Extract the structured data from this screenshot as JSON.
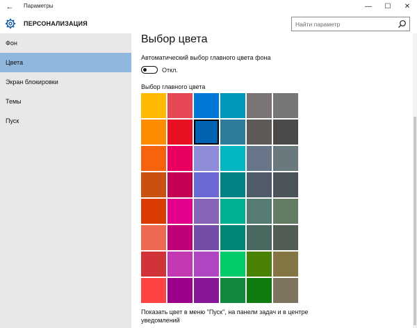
{
  "window": {
    "back_glyph": "←",
    "title": "Параметры",
    "minimize_glyph": "—",
    "maximize_glyph": "☐",
    "close_glyph": "✕"
  },
  "header": {
    "title": "ПЕРСОНАЛИЗАЦИЯ",
    "icon": "gear-icon",
    "search_placeholder": "Найти параметр"
  },
  "sidebar": {
    "items": [
      {
        "label": "Фон"
      },
      {
        "label": "Цвета"
      },
      {
        "label": "Экран блокировки"
      },
      {
        "label": "Темы"
      },
      {
        "label": "Пуск"
      }
    ],
    "active_index": 1,
    "active_color": "#90b7dc"
  },
  "main": {
    "title": "Выбор цвета",
    "auto_label": "Автоматический выбор главного цвета фона",
    "toggle_state": "Откл.",
    "toggle_on": false,
    "color_label": "Выбор главного цвета",
    "selected_color_index": 8,
    "colors": [
      "#ffb900",
      "#e74856",
      "#0078d7",
      "#0099bc",
      "#7a7574",
      "#767676",
      "#ff8c00",
      "#e81123",
      "#0063b1",
      "#2d7d9a",
      "#5d5a58",
      "#4c4a48",
      "#f7630c",
      "#ea005e",
      "#8e8cd8",
      "#00b7c3",
      "#68768a",
      "#69797e",
      "#ca5010",
      "#c30052",
      "#6b69d6",
      "#038387",
      "#515c6b",
      "#4a5459",
      "#da3b01",
      "#e3008c",
      "#8764b8",
      "#00b294",
      "#567c73",
      "#647c64",
      "#ef6950",
      "#bf0077",
      "#744da9",
      "#018574",
      "#486860",
      "#525e54",
      "#d13438",
      "#c239b3",
      "#b146c2",
      "#00cc6a",
      "#498205",
      "#847545",
      "#ff4343",
      "#9a0089",
      "#881798",
      "#10893e",
      "#107c10",
      "#7e735f"
    ],
    "footer": "Показать цвет в меню \"Пуск\", на панели задач и в центре уведомлений"
  }
}
